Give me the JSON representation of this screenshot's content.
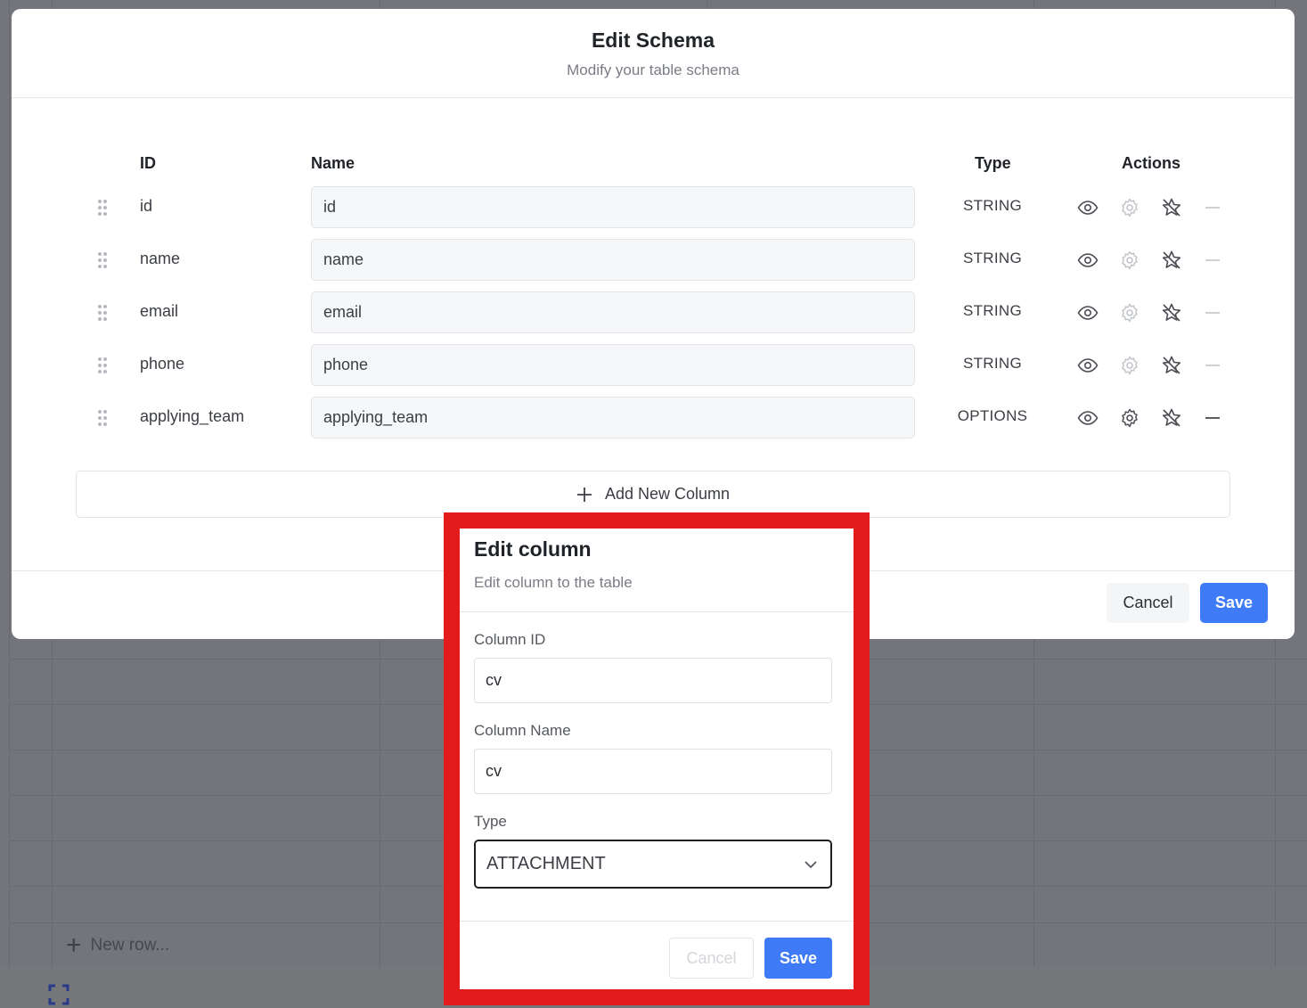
{
  "background": {
    "new_row_label": "New row..."
  },
  "schema_modal": {
    "title": "Edit Schema",
    "subtitle": "Modify your table schema",
    "headers": {
      "id": "ID",
      "name": "Name",
      "type": "Type",
      "actions": "Actions"
    },
    "rows": [
      {
        "id": "id",
        "name": "id",
        "type": "STRING",
        "settings_enabled": false
      },
      {
        "id": "name",
        "name": "name",
        "type": "STRING",
        "settings_enabled": false
      },
      {
        "id": "email",
        "name": "email",
        "type": "STRING",
        "settings_enabled": false
      },
      {
        "id": "phone",
        "name": "phone",
        "type": "STRING",
        "settings_enabled": false
      },
      {
        "id": "applying_team",
        "name": "applying_team",
        "type": "OPTIONS",
        "settings_enabled": true
      }
    ],
    "add_column_label": "Add New Column",
    "cancel_label": "Cancel",
    "save_label": "Save"
  },
  "edit_column_dialog": {
    "title": "Edit column",
    "subtitle": "Edit column to the table",
    "column_id_label": "Column ID",
    "column_id_value": "cv",
    "column_name_label": "Column Name",
    "column_name_value": "cv",
    "type_label": "Type",
    "type_value": "ATTACHMENT",
    "cancel_label": "Cancel",
    "save_label": "Save"
  },
  "colors": {
    "accent": "#3f7bf6",
    "highlight": "#e41b1b"
  }
}
